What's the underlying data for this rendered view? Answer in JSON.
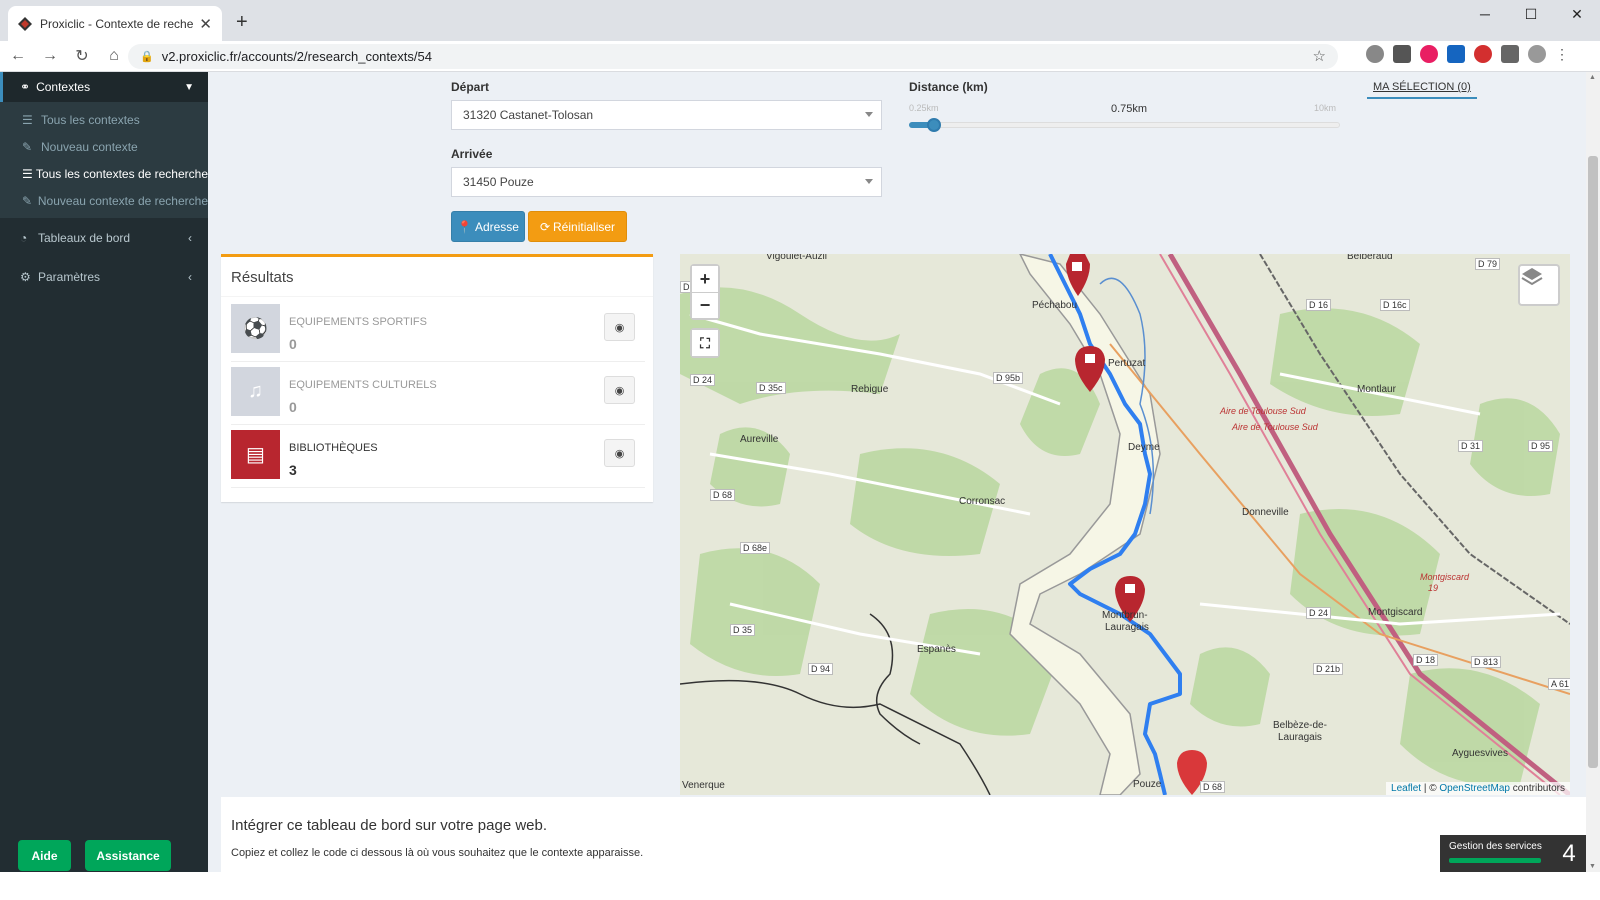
{
  "browser": {
    "tab_title": "Proxiclic - Contexte de recherche",
    "url": "v2.proxiclic.fr/accounts/2/research_contexts/54"
  },
  "sidebar": {
    "section": "Contextes",
    "sub_items": [
      {
        "label": "Tous les contextes",
        "icon": "list-icon"
      },
      {
        "label": "Nouveau contexte",
        "icon": "edit-icon"
      },
      {
        "label": "Tous les contextes de recherche",
        "icon": "list-icon",
        "active": true
      },
      {
        "label": "Nouveau contexte de recherche",
        "icon": "edit-icon"
      }
    ],
    "items": [
      {
        "label": "Tableaux de bord",
        "icon": "dashboard-icon"
      },
      {
        "label": "Paramètres",
        "icon": "gear-icon"
      }
    ],
    "help_label": "Aide",
    "assist_label": "Assistance"
  },
  "form": {
    "depart_label": "Départ",
    "depart_value": "31320 Castanet-Tolosan",
    "arrivee_label": "Arrivée",
    "arrivee_value": "31450 Pouze",
    "adresse_label": "Adresse",
    "reset_label": "Réinitialiser",
    "distance_label": "Distance (km)",
    "distance_min": "0.25km",
    "distance_value": "0.75km",
    "distance_max": "10km",
    "distance_fraction": 0.05,
    "selection_label": "MA SÉLECTION (0)"
  },
  "results": {
    "title": "Résultats",
    "items": [
      {
        "name": "EQUIPEMENTS SPORTIFS",
        "count": "0",
        "icon": "soccer-ball-icon",
        "color": "#d2d6de",
        "text_color": "#999"
      },
      {
        "name": "EQUIPEMENTS CULTURELS",
        "count": "0",
        "icon": "music-note-icon",
        "color": "#d2d6de",
        "text_color": "#999"
      },
      {
        "name": "BIBLIOTHÈQUES",
        "count": "3",
        "icon": "book-icon",
        "color": "#b8262f",
        "text_color": "#333"
      }
    ]
  },
  "map": {
    "labels": {
      "vigoulet": "Vigoulet-Auzil",
      "pechabou": "Péchabou",
      "pertuzat": "Pertuzat",
      "rebigue": "Rebigue",
      "aureville": "Aureville",
      "deyme": "Deyme",
      "corronsac": "Corronsac",
      "donneville": "Donneville",
      "montlaur": "Montlaur",
      "belberaud": "Belberaud",
      "montbrun": "Montbrun-",
      "lauragais": "Lauragais",
      "espanes": "Espanès",
      "montgiscard": "Montgiscard",
      "belbeze1": "Belbèze-de-",
      "belbeze2": "Lauragais",
      "ayguesvives": "Ayguesvives",
      "pouze": "Pouze",
      "venerque": "Venerque",
      "aire1": "Aire de Toulouse Sud",
      "aire2": "Aire de Toulouse Sud",
      "montgiscard_aire1": "Montgiscard",
      "montgiscard_aire2": "19",
      "d79": "D 79",
      "d16": "D 16",
      "d16c": "D 16c",
      "d24a": "D 24",
      "d35c": "D 35c",
      "d95b": "D 95b",
      "d31": "D 31",
      "d95": "D 95",
      "d68": "D 68",
      "d68e": "D 68e",
      "d35": "D 35",
      "d94": "D 94",
      "d24b": "D 24",
      "d21b": "D 21b",
      "d18": "D 18",
      "d813": "D 813",
      "a61": "A 61",
      "d68b": "D 68",
      "d": "D"
    },
    "attribution": {
      "leaflet": "Leaflet",
      "sep": " | © ",
      "osm": "OpenStreetMap",
      "contrib": " contributors"
    }
  },
  "embed": {
    "title": "Intégrer ce tableau de bord sur votre page web.",
    "desc": "Copiez et collez le code ci dessous là où vous souhaitez que le contexte apparaisse."
  },
  "gestion": {
    "label": "Gestion des services",
    "count": "4"
  }
}
